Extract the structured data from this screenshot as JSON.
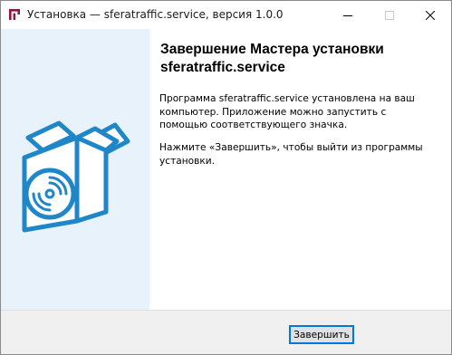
{
  "window": {
    "title": "Установка — sferatraffic.service, версия 1.0.0",
    "controls": {
      "minimize_icon": "minimize-icon",
      "maximize_icon": "maximize-icon",
      "close_icon": "close-icon"
    }
  },
  "colors": {
    "side_panel": "#e8f2fa",
    "box_blue": "#1f86c8",
    "accent_button_border": "#0078d7",
    "footer": "#f0f0f0"
  },
  "main": {
    "heading": "Завершение Мастера установки sferatraffic.service",
    "paragraph1": "Программа sferatraffic.service установлена на ваш компьютер. Приложение можно запустить с помощью соответствующего значка.",
    "paragraph2": "Нажмите «Завершить», чтобы выйти из программы установки."
  },
  "footer": {
    "finish_label": "Завершить"
  }
}
